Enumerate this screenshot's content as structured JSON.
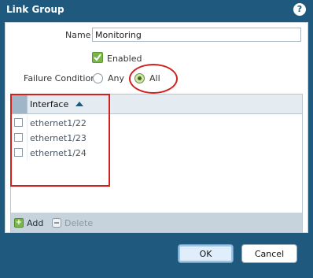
{
  "window": {
    "title": "Link Group",
    "help_label": "?"
  },
  "form": {
    "name_label": "Name",
    "name_value": "Monitoring",
    "enabled_label": "Enabled",
    "enabled_checked": true,
    "failure_condition_label": "Failure Condition",
    "options": [
      {
        "label": "Any",
        "selected": false
      },
      {
        "label": "All",
        "selected": true
      }
    ]
  },
  "grid": {
    "column_header": "Interface",
    "rows": [
      "ethernet1/22",
      "ethernet1/23",
      "ethernet1/24"
    ]
  },
  "toolbar": {
    "add_label": "Add",
    "delete_label": "Delete"
  },
  "buttons": {
    "ok_label": "OK",
    "cancel_label": "Cancel"
  },
  "colors": {
    "title_bar": "#1f5a7e",
    "annotation": "#d0211f",
    "enabled_check": "#7ab648"
  }
}
